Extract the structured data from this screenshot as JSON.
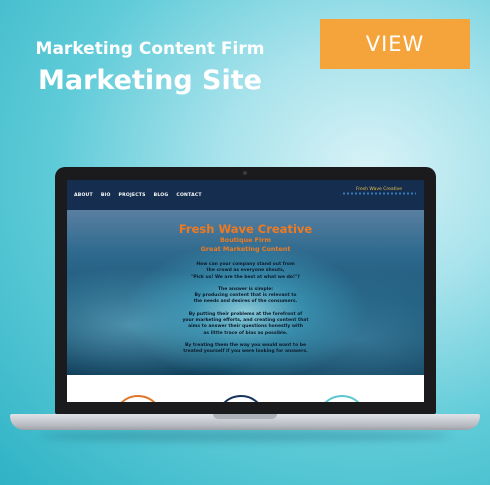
{
  "header": {
    "eyebrow": "Marketing Content Firm",
    "headline": "Marketing Site",
    "view_label": "VIEW"
  },
  "colors": {
    "accent": "#f4a43a",
    "site_nav": "#152d4f",
    "hero_title": "#f07a20"
  },
  "site": {
    "nav": [
      "ABOUT",
      "BIO",
      "PROJECTS",
      "BLOG",
      "CONTACT"
    ],
    "logo_text": "Fresh Wave Creative",
    "hero": {
      "title": "Fresh Wave Creative",
      "subtitle1": "Boutique Firm",
      "subtitle2": "Great Marketing Content",
      "paragraphs": [
        "How can your company stand out from\nthe crowd as everyone shouts,\n\"Pick us! We are the best at what we do!\"?",
        "The answer is simple:\nBy producing content that is relevant to\nthe needs and desires of the consumers.",
        "By putting their problems at the forefront of\nyour marketing efforts, and creating content that\naims to answer their questions honestly with\nas little trace of bias as possible.",
        "By treating them the way you would want to be\ntreated yourself if you were looking for answers."
      ]
    },
    "ring_colors": [
      "#e0762a",
      "#17345a",
      "#5fc6d3"
    ]
  }
}
